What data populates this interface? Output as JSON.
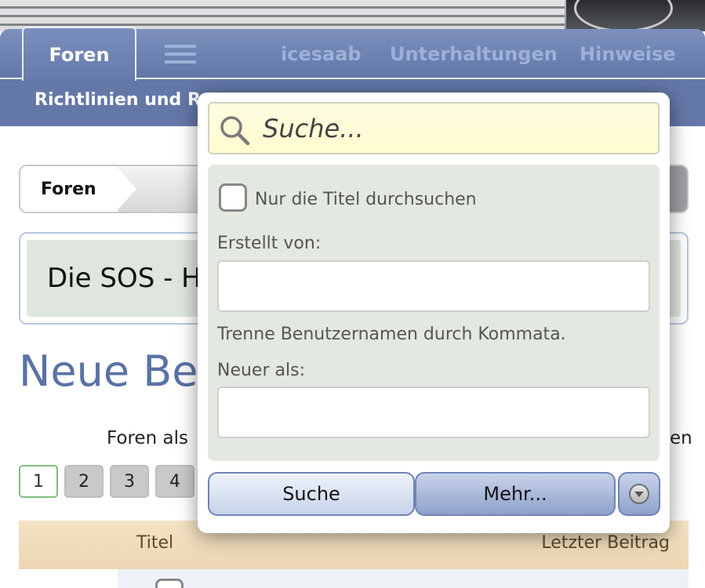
{
  "nav": {
    "tabs": [
      {
        "label": "Foren",
        "active": true
      },
      {
        "label": "icesaab",
        "active": false
      },
      {
        "label": "Unterhaltungen",
        "active": false
      },
      {
        "label": "Hinweise",
        "active": false
      }
    ],
    "menu_icon": "hamburger-menu-icon",
    "subnav_label": "Richtlinien und R"
  },
  "breadcrumb": {
    "label": "Foren"
  },
  "forum_title": "Die SOS - H",
  "page_title": "Neue Bei",
  "forenals": "Foren als",
  "trailing_text": "en",
  "pagination": {
    "pages": [
      "1",
      "2",
      "3",
      "4"
    ],
    "current": "1"
  },
  "table": {
    "col_title": "Titel",
    "col_last": "Letzter Beitrag"
  },
  "search_panel": {
    "placeholder": "Suche...",
    "search_icon": "magnifier-icon",
    "titles_only_label": "Nur die Titel durchsuchen",
    "created_by_label": "Erstellt von:",
    "created_by_value": "",
    "separate_hint": "Trenne Benutzernamen durch Kommata.",
    "newer_than_label": "Neuer als:",
    "newer_than_value": "",
    "search_button": "Suche",
    "more_button": "Mehr...",
    "toggle_icon": "chevron-down-circle-icon"
  },
  "colors": {
    "nav_blue": "#6478a8",
    "title_blue": "#5a72a6",
    "search_bg": "#fffbe0",
    "options_bg": "#e3e8e1",
    "table_head": "#f4e2c4"
  }
}
